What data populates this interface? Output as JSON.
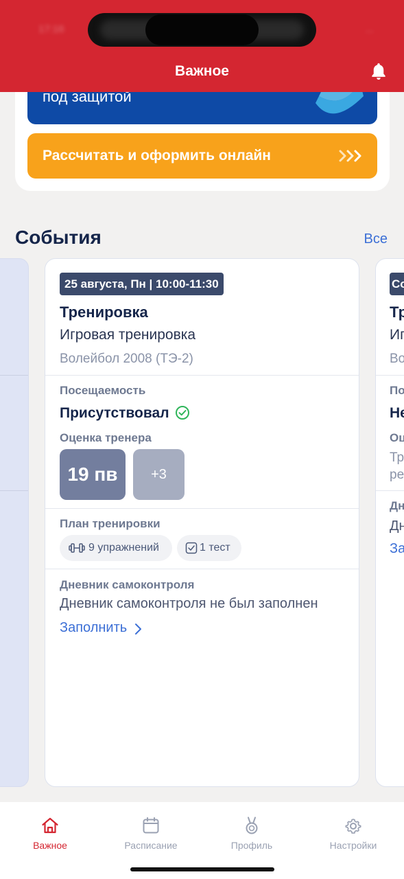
{
  "status_bar": {
    "time": "17:16",
    "icons": "..."
  },
  "header": {
    "title": "Важное"
  },
  "promo": {
    "banner_text": "под защитой",
    "cta_label": "Рассчитать и оформить онлайн"
  },
  "events": {
    "title": "События",
    "all_link": "Все",
    "card": {
      "date": "25 августа, Пн | 10:00-11:30",
      "type": "Тренировка",
      "name": "Игровая тренировка",
      "group": "Волейбол 2008 (ТЭ-2)",
      "attendance_label": "Посещаемость",
      "attendance_value": "Присутствовал",
      "grade_label": "Оценка тренера",
      "grade_main": "19 пв",
      "grade_more": "+3",
      "plan_label": "План тренировки",
      "exercises": "9 упражнений",
      "tests": "1 тест",
      "diary_label": "Дневник самоконтроля",
      "diary_text": "Дневник самоконтроля не был заполнен",
      "fill_link": "Заполнить"
    },
    "peek_card": {
      "badge": "Со",
      "type": "Тр",
      "name": "Иг",
      "group": "Во",
      "attendance_label": "По",
      "attendance_value": "Не",
      "grade_label": "Оц",
      "grade_text_1": "Тр",
      "grade_text_2": "ре",
      "diary_label": "Дн",
      "diary_text": "Дн",
      "fill_link": "За"
    }
  },
  "nav": {
    "items": [
      {
        "label": "Важное",
        "icon": "home-icon",
        "active": true
      },
      {
        "label": "Расписание",
        "icon": "calendar-icon",
        "active": false
      },
      {
        "label": "Профиль",
        "icon": "medal-icon",
        "active": false
      },
      {
        "label": "Настройки",
        "icon": "gear-icon",
        "active": false
      }
    ]
  },
  "colors": {
    "brand_red": "#d42631",
    "accent_blue": "#3c6fd6",
    "orange": "#f8a21b",
    "banner_blue": "#0e4aa6"
  }
}
